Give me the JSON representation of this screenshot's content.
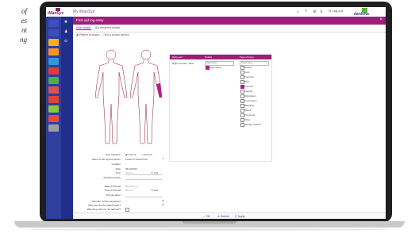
{
  "side_text": [
    "of",
    "es",
    "nt",
    "ng"
  ],
  "topbar": {
    "logo_text": "iManSys",
    "app_title": "My iManSys",
    "logout_label": "Log out",
    "brand_text": "danieha"
  },
  "header": {
    "title": "First aid log entry",
    "close": "×"
  },
  "tabs": [
    {
      "label": "Main details",
      "active": true
    },
    {
      "label": "Aid rendered details",
      "active": false
    }
  ],
  "radios": {
    "option1": "Patient is known",
    "option2": "Not a known person"
  },
  "grid": {
    "headers": [
      "Body part",
      "Details",
      "Type of injury"
    ],
    "body_part": "Right Forearm: back",
    "detail_dropdown": "Light elbow",
    "detail_checked": "Light elbow",
    "injury_dropdown": "Select injury",
    "injuries": [
      {
        "label": "Strains",
        "checked": false
      },
      {
        "label": "Cuts",
        "checked": false
      },
      {
        "label": "Puncture",
        "checked": false
      },
      {
        "label": "Burn",
        "checked": false
      },
      {
        "label": "Fracture",
        "checked": true
      },
      {
        "label": "Foreign",
        "checked": false
      },
      {
        "label": "Dislocation",
        "checked": false
      },
      {
        "label": "Concussion",
        "checked": false
      },
      {
        "label": "Bleeding",
        "checked": false
      },
      {
        "label": "Shock",
        "checked": false
      },
      {
        "label": "Poisoning",
        "checked": false
      },
      {
        "label": "Other",
        "checked": false
      },
      {
        "label": "Allergic reaction",
        "checked": false
      }
    ]
  },
  "form": {
    "user_selection_label": "User selection",
    "user_opt1": "Internal",
    "user_opt2": "External",
    "injured_name_label": "Name of the injured person",
    "injured_name_value": "PHANTO MAGUVZA",
    "location_label": "Location",
    "date_label": "Date",
    "date_value": "05/10/2022",
    "time_label": "Time",
    "time_value": "Hh:mm",
    "time_zone": "Y/-Usd",
    "accident_label": "Accident Activity",
    "firstaid_date_label": "Date of first aid",
    "firstaid_date_value": "dd/mm/yyyy",
    "firstaid_time_label": "Time of first aid",
    "firstaid_time_value": "Hh:mm",
    "firstaid_time_zone": "Y/-Usd",
    "firstaid_given_label": "First aid given",
    "responder_label": "Member of first responders",
    "contact_label": "Who else did the patient refer?",
    "referred_label": "Was the person to not referred?"
  },
  "footer": {
    "ok": "OK",
    "submit": "Submit",
    "apply": "Apply"
  },
  "colors": {
    "accent": "#9b1f7a",
    "nav": "#2e3f9e"
  }
}
